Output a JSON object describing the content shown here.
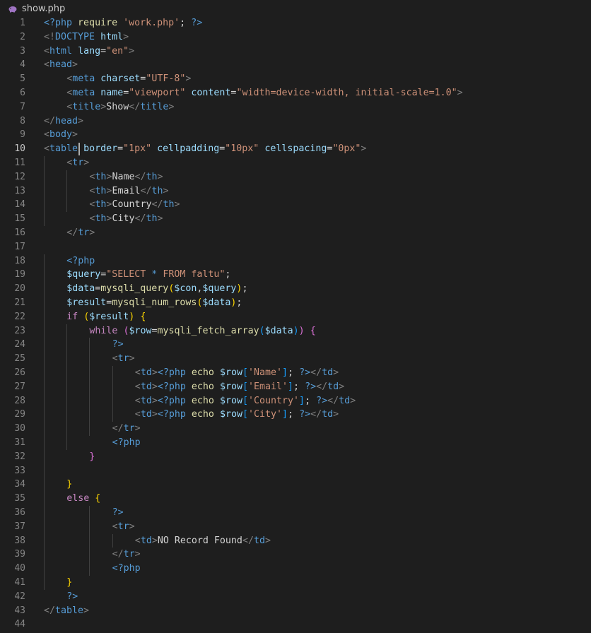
{
  "tab": {
    "filename": "show.php",
    "icon": "php-elephant-icon",
    "icon_color": "#a074c4"
  },
  "editor": {
    "current_line": 10,
    "colors": {
      "background": "#1e1e1e",
      "tag": "#569cd6",
      "attribute": "#9cdcfe",
      "string": "#ce9178",
      "text": "#d4d4d4"
    },
    "lines": [
      {
        "n": "1",
        "indent": 0,
        "tokens": [
          [
            "kw",
            "<?php"
          ],
          [
            "txt",
            " "
          ],
          [
            "fn",
            "require"
          ],
          [
            "txt",
            " "
          ],
          [
            "str",
            "'work.php'"
          ],
          [
            "txt",
            "; "
          ],
          [
            "kw",
            "?>"
          ]
        ]
      },
      {
        "n": "2",
        "indent": 0,
        "tokens": [
          [
            "punc",
            "<!"
          ],
          [
            "tag",
            "DOCTYPE"
          ],
          [
            "txt",
            " "
          ],
          [
            "attr",
            "html"
          ],
          [
            "punc",
            ">"
          ]
        ]
      },
      {
        "n": "3",
        "indent": 0,
        "tokens": [
          [
            "punc",
            "<"
          ],
          [
            "tag",
            "html"
          ],
          [
            "txt",
            " "
          ],
          [
            "attr",
            "lang"
          ],
          [
            "txt",
            "="
          ],
          [
            "str",
            "\"en\""
          ],
          [
            "punc",
            ">"
          ]
        ]
      },
      {
        "n": "4",
        "indent": 0,
        "tokens": [
          [
            "punc",
            "<"
          ],
          [
            "tag",
            "head"
          ],
          [
            "punc",
            ">"
          ]
        ]
      },
      {
        "n": "5",
        "indent": 1,
        "tokens": [
          [
            "punc",
            "<"
          ],
          [
            "tag",
            "meta"
          ],
          [
            "txt",
            " "
          ],
          [
            "attr",
            "charset"
          ],
          [
            "txt",
            "="
          ],
          [
            "str",
            "\"UTF-8\""
          ],
          [
            "punc",
            ">"
          ]
        ]
      },
      {
        "n": "6",
        "indent": 1,
        "tokens": [
          [
            "punc",
            "<"
          ],
          [
            "tag",
            "meta"
          ],
          [
            "txt",
            " "
          ],
          [
            "attr",
            "name"
          ],
          [
            "txt",
            "="
          ],
          [
            "str",
            "\"viewport\""
          ],
          [
            "txt",
            " "
          ],
          [
            "attr",
            "content"
          ],
          [
            "txt",
            "="
          ],
          [
            "str",
            "\"width=device-width, initial-scale=1.0\""
          ],
          [
            "punc",
            ">"
          ]
        ]
      },
      {
        "n": "7",
        "indent": 1,
        "tokens": [
          [
            "punc",
            "<"
          ],
          [
            "tag",
            "title"
          ],
          [
            "punc",
            ">"
          ],
          [
            "txt",
            "Show"
          ],
          [
            "punc",
            "</"
          ],
          [
            "tag",
            "title"
          ],
          [
            "punc",
            ">"
          ]
        ]
      },
      {
        "n": "8",
        "indent": 0,
        "tokens": [
          [
            "punc",
            "</"
          ],
          [
            "tag",
            "head"
          ],
          [
            "punc",
            ">"
          ]
        ]
      },
      {
        "n": "9",
        "indent": 0,
        "tokens": [
          [
            "punc",
            "<"
          ],
          [
            "tag",
            "body"
          ],
          [
            "punc",
            ">"
          ]
        ]
      },
      {
        "n": "10",
        "indent": 0,
        "tokens": [
          [
            "punc",
            "<"
          ],
          [
            "tag",
            "table"
          ],
          [
            "txt",
            " "
          ],
          [
            "attr",
            "border"
          ],
          [
            "txt",
            "="
          ],
          [
            "str",
            "\"1px\""
          ],
          [
            "txt",
            " "
          ],
          [
            "attr",
            "cellpadding"
          ],
          [
            "txt",
            "="
          ],
          [
            "str",
            "\"10px\""
          ],
          [
            "txt",
            " "
          ],
          [
            "attr",
            "cellspacing"
          ],
          [
            "txt",
            "="
          ],
          [
            "str",
            "\"0px\""
          ],
          [
            "punc",
            ">"
          ]
        ]
      },
      {
        "n": "11",
        "indent": 1,
        "tokens": [
          [
            "punc",
            "<"
          ],
          [
            "tag",
            "tr"
          ],
          [
            "punc",
            ">"
          ]
        ]
      },
      {
        "n": "12",
        "indent": 2,
        "tokens": [
          [
            "punc",
            "<"
          ],
          [
            "tag",
            "th"
          ],
          [
            "punc",
            ">"
          ],
          [
            "txt",
            "Name"
          ],
          [
            "punc",
            "</"
          ],
          [
            "tag",
            "th"
          ],
          [
            "punc",
            ">"
          ]
        ]
      },
      {
        "n": "13",
        "indent": 2,
        "tokens": [
          [
            "punc",
            "<"
          ],
          [
            "tag",
            "th"
          ],
          [
            "punc",
            ">"
          ],
          [
            "txt",
            "Email"
          ],
          [
            "punc",
            "</"
          ],
          [
            "tag",
            "th"
          ],
          [
            "punc",
            ">"
          ]
        ]
      },
      {
        "n": "14",
        "indent": 2,
        "tokens": [
          [
            "punc",
            "<"
          ],
          [
            "tag",
            "th"
          ],
          [
            "punc",
            ">"
          ],
          [
            "txt",
            "Country"
          ],
          [
            "punc",
            "</"
          ],
          [
            "tag",
            "th"
          ],
          [
            "punc",
            ">"
          ]
        ]
      },
      {
        "n": "15",
        "indent": 2,
        "tokens": [
          [
            "punc",
            "<"
          ],
          [
            "tag",
            "th"
          ],
          [
            "punc",
            ">"
          ],
          [
            "txt",
            "City"
          ],
          [
            "punc",
            "</"
          ],
          [
            "tag",
            "th"
          ],
          [
            "punc",
            ">"
          ]
        ]
      },
      {
        "n": "16",
        "indent": 1,
        "tokens": [
          [
            "punc",
            "</"
          ],
          [
            "tag",
            "tr"
          ],
          [
            "punc",
            ">"
          ]
        ]
      },
      {
        "n": "17",
        "indent": 0,
        "tokens": []
      },
      {
        "n": "18",
        "indent": 1,
        "tokens": [
          [
            "kw",
            "<?php"
          ]
        ]
      },
      {
        "n": "19",
        "indent": 1,
        "tokens": [
          [
            "var",
            "$query"
          ],
          [
            "txt",
            "="
          ],
          [
            "str",
            "\"SELECT "
          ],
          [
            "kw",
            "*"
          ],
          [
            "str",
            " FROM faltu\""
          ],
          [
            "txt",
            ";"
          ]
        ]
      },
      {
        "n": "20",
        "indent": 1,
        "tokens": [
          [
            "var",
            "$data"
          ],
          [
            "txt",
            "="
          ],
          [
            "fn",
            "mysqli_query"
          ],
          [
            "b1",
            "("
          ],
          [
            "var",
            "$con"
          ],
          [
            "txt",
            ","
          ],
          [
            "var",
            "$query"
          ],
          [
            "b1",
            ")"
          ],
          [
            "txt",
            ";"
          ]
        ]
      },
      {
        "n": "21",
        "indent": 1,
        "tokens": [
          [
            "var",
            "$result"
          ],
          [
            "txt",
            "="
          ],
          [
            "fn",
            "mysqli_num_rows"
          ],
          [
            "b1",
            "("
          ],
          [
            "var",
            "$data"
          ],
          [
            "b1",
            ")"
          ],
          [
            "txt",
            ";"
          ]
        ]
      },
      {
        "n": "22",
        "indent": 1,
        "tokens": [
          [
            "ctl",
            "if"
          ],
          [
            "txt",
            " "
          ],
          [
            "b1",
            "("
          ],
          [
            "var",
            "$result"
          ],
          [
            "b1",
            ")"
          ],
          [
            "txt",
            " "
          ],
          [
            "b1",
            "{"
          ]
        ]
      },
      {
        "n": "23",
        "indent": 2,
        "tokens": [
          [
            "ctl",
            "while"
          ],
          [
            "txt",
            " "
          ],
          [
            "b2",
            "("
          ],
          [
            "var",
            "$row"
          ],
          [
            "txt",
            "="
          ],
          [
            "fn",
            "mysqli_fetch_array"
          ],
          [
            "b3",
            "("
          ],
          [
            "var",
            "$data"
          ],
          [
            "b3",
            ")"
          ],
          [
            "b2",
            ")"
          ],
          [
            "txt",
            " "
          ],
          [
            "b2",
            "{"
          ]
        ]
      },
      {
        "n": "24",
        "indent": 3,
        "tokens": [
          [
            "kw",
            "?>"
          ]
        ]
      },
      {
        "n": "25",
        "indent": 3,
        "tokens": [
          [
            "punc",
            "<"
          ],
          [
            "tag",
            "tr"
          ],
          [
            "punc",
            ">"
          ]
        ]
      },
      {
        "n": "26",
        "indent": 4,
        "tokens": [
          [
            "punc",
            "<"
          ],
          [
            "tag",
            "td"
          ],
          [
            "punc",
            ">"
          ],
          [
            "kw",
            "<?php"
          ],
          [
            "txt",
            " "
          ],
          [
            "fn",
            "echo"
          ],
          [
            "txt",
            " "
          ],
          [
            "var",
            "$row"
          ],
          [
            "b3",
            "["
          ],
          [
            "str",
            "'Name'"
          ],
          [
            "b3",
            "]"
          ],
          [
            "txt",
            "; "
          ],
          [
            "kw",
            "?>"
          ],
          [
            "punc",
            "</"
          ],
          [
            "tag",
            "td"
          ],
          [
            "punc",
            ">"
          ]
        ]
      },
      {
        "n": "27",
        "indent": 4,
        "tokens": [
          [
            "punc",
            "<"
          ],
          [
            "tag",
            "td"
          ],
          [
            "punc",
            ">"
          ],
          [
            "kw",
            "<?php"
          ],
          [
            "txt",
            " "
          ],
          [
            "fn",
            "echo"
          ],
          [
            "txt",
            " "
          ],
          [
            "var",
            "$row"
          ],
          [
            "b3",
            "["
          ],
          [
            "str",
            "'Email'"
          ],
          [
            "b3",
            "]"
          ],
          [
            "txt",
            "; "
          ],
          [
            "kw",
            "?>"
          ],
          [
            "punc",
            "</"
          ],
          [
            "tag",
            "td"
          ],
          [
            "punc",
            ">"
          ]
        ]
      },
      {
        "n": "28",
        "indent": 4,
        "tokens": [
          [
            "punc",
            "<"
          ],
          [
            "tag",
            "td"
          ],
          [
            "punc",
            ">"
          ],
          [
            "kw",
            "<?php"
          ],
          [
            "txt",
            " "
          ],
          [
            "fn",
            "echo"
          ],
          [
            "txt",
            " "
          ],
          [
            "var",
            "$row"
          ],
          [
            "b3",
            "["
          ],
          [
            "str",
            "'Country'"
          ],
          [
            "b3",
            "]"
          ],
          [
            "txt",
            "; "
          ],
          [
            "kw",
            "?>"
          ],
          [
            "punc",
            "</"
          ],
          [
            "tag",
            "td"
          ],
          [
            "punc",
            ">"
          ]
        ]
      },
      {
        "n": "29",
        "indent": 4,
        "tokens": [
          [
            "punc",
            "<"
          ],
          [
            "tag",
            "td"
          ],
          [
            "punc",
            ">"
          ],
          [
            "kw",
            "<?php"
          ],
          [
            "txt",
            " "
          ],
          [
            "fn",
            "echo"
          ],
          [
            "txt",
            " "
          ],
          [
            "var",
            "$row"
          ],
          [
            "b3",
            "["
          ],
          [
            "str",
            "'City'"
          ],
          [
            "b3",
            "]"
          ],
          [
            "txt",
            "; "
          ],
          [
            "kw",
            "?>"
          ],
          [
            "punc",
            "</"
          ],
          [
            "tag",
            "td"
          ],
          [
            "punc",
            ">"
          ]
        ]
      },
      {
        "n": "30",
        "indent": 3,
        "tokens": [
          [
            "punc",
            "</"
          ],
          [
            "tag",
            "tr"
          ],
          [
            "punc",
            ">"
          ]
        ]
      },
      {
        "n": "31",
        "indent": 3,
        "tokens": [
          [
            "kw",
            "<?php"
          ]
        ]
      },
      {
        "n": "32",
        "indent": 2,
        "tokens": [
          [
            "b2",
            "}"
          ]
        ]
      },
      {
        "n": "33",
        "indent": 0,
        "tokens": []
      },
      {
        "n": "34",
        "indent": 1,
        "tokens": [
          [
            "b1",
            "}"
          ]
        ]
      },
      {
        "n": "35",
        "indent": 1,
        "tokens": [
          [
            "ctl",
            "else"
          ],
          [
            "txt",
            " "
          ],
          [
            "b1",
            "{"
          ]
        ]
      },
      {
        "n": "36",
        "indent": 3,
        "tokens": [
          [
            "kw",
            "?>"
          ]
        ]
      },
      {
        "n": "37",
        "indent": 3,
        "tokens": [
          [
            "punc",
            "<"
          ],
          [
            "tag",
            "tr"
          ],
          [
            "punc",
            ">"
          ]
        ]
      },
      {
        "n": "38",
        "indent": 4,
        "tokens": [
          [
            "punc",
            "<"
          ],
          [
            "tag",
            "td"
          ],
          [
            "punc",
            ">"
          ],
          [
            "txt",
            "NO Record Found"
          ],
          [
            "punc",
            "</"
          ],
          [
            "tag",
            "td"
          ],
          [
            "punc",
            ">"
          ]
        ]
      },
      {
        "n": "39",
        "indent": 3,
        "tokens": [
          [
            "punc",
            "</"
          ],
          [
            "tag",
            "tr"
          ],
          [
            "punc",
            ">"
          ]
        ]
      },
      {
        "n": "40",
        "indent": 3,
        "tokens": [
          [
            "kw",
            "<?php"
          ]
        ]
      },
      {
        "n": "41",
        "indent": 1,
        "tokens": [
          [
            "b1",
            "}"
          ]
        ]
      },
      {
        "n": "42",
        "indent": 1,
        "tokens": [
          [
            "kw",
            "?>"
          ]
        ]
      },
      {
        "n": "43",
        "indent": 0,
        "tokens": [
          [
            "punc",
            "</"
          ],
          [
            "tag",
            "table"
          ],
          [
            "punc",
            ">"
          ]
        ]
      },
      {
        "n": "44",
        "indent": 0,
        "tokens": []
      }
    ]
  }
}
